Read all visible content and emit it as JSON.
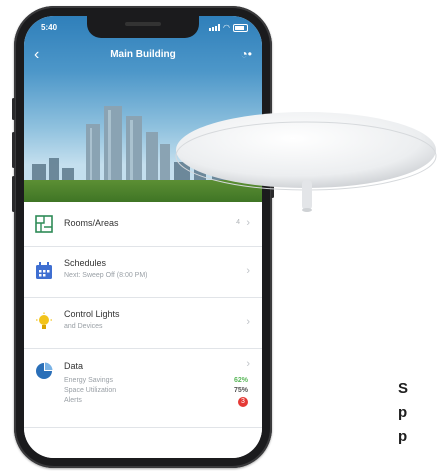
{
  "status_bar": {
    "time": "5:40"
  },
  "header": {
    "title": "Main Building",
    "back_icon": "chevron-left-icon",
    "action_icon": "wifi-key-icon"
  },
  "menu": [
    {
      "label": "Rooms/Areas",
      "sub": "",
      "count": "4",
      "icon": "floorplan-icon",
      "icon_color": "#2e8b57"
    },
    {
      "label": "Schedules",
      "sub": "Next: Sweep Off (8:00 PM)",
      "icon": "calendar-icon",
      "icon_color": "#3f6fd1"
    },
    {
      "label": "Control Lights",
      "sub": "and Devices",
      "icon": "lightbulb-icon",
      "icon_color": "#f2c31a"
    },
    {
      "label": "Data",
      "icon": "pie-chart-icon",
      "icon_color": "#2a6fb8",
      "metrics": [
        {
          "name": "Energy Savings",
          "value": "62%",
          "color": "#5cb85c"
        },
        {
          "name": "Space Utilization",
          "value": "75%",
          "color": "#555555"
        },
        {
          "name": "Alerts",
          "value": "3",
          "color": "#e53935"
        }
      ]
    }
  ],
  "caption": [
    "S",
    "p",
    "p"
  ]
}
